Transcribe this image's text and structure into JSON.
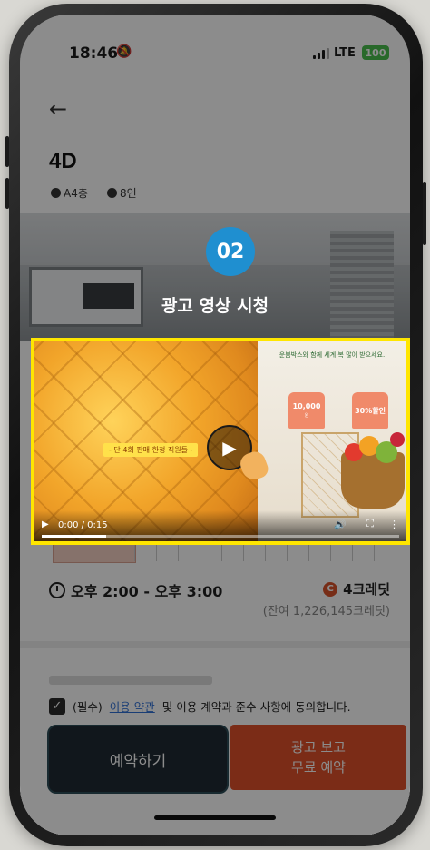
{
  "status_bar": {
    "time": "18:46",
    "network": "LTE",
    "battery": "100"
  },
  "header": {
    "back_icon": "←",
    "room_name": "4D",
    "floor": "A4층",
    "capacity": "8인"
  },
  "overlay": {
    "step_number": "02",
    "step_label": "광고 영상 시청",
    "video": {
      "left_caption": "- 단 4회 판매 한정 직원들 -",
      "right_title": "운봄박스와 함께 세계 복 많이 받으세요.",
      "tag1": {
        "value": "10,000",
        "unit": "원"
      },
      "tag2": {
        "value": "30%할인",
        "unit": ""
      },
      "time_display": "0:00 / 0:15",
      "progress": 0.18
    }
  },
  "booking": {
    "time_range": "오후 2:00 - 오후 3:00",
    "credit_cost": "4크레딧",
    "balance": "(잔여 1,226,145크레딧)",
    "agreement": {
      "prefix": "(필수)",
      "link": "이용 약관",
      "suffix": "및 이용 계약과 준수 사항에 동의합니다."
    },
    "reserve_button": "예약하기",
    "ad_button_line1": "광고 보고",
    "ad_button_line2": "무료 예약"
  },
  "colors": {
    "accent_blue": "#1f8fd0",
    "highlight_yellow": "#ffe600",
    "primary_orange": "#e0512a",
    "dark_button": "#1f2b33"
  }
}
